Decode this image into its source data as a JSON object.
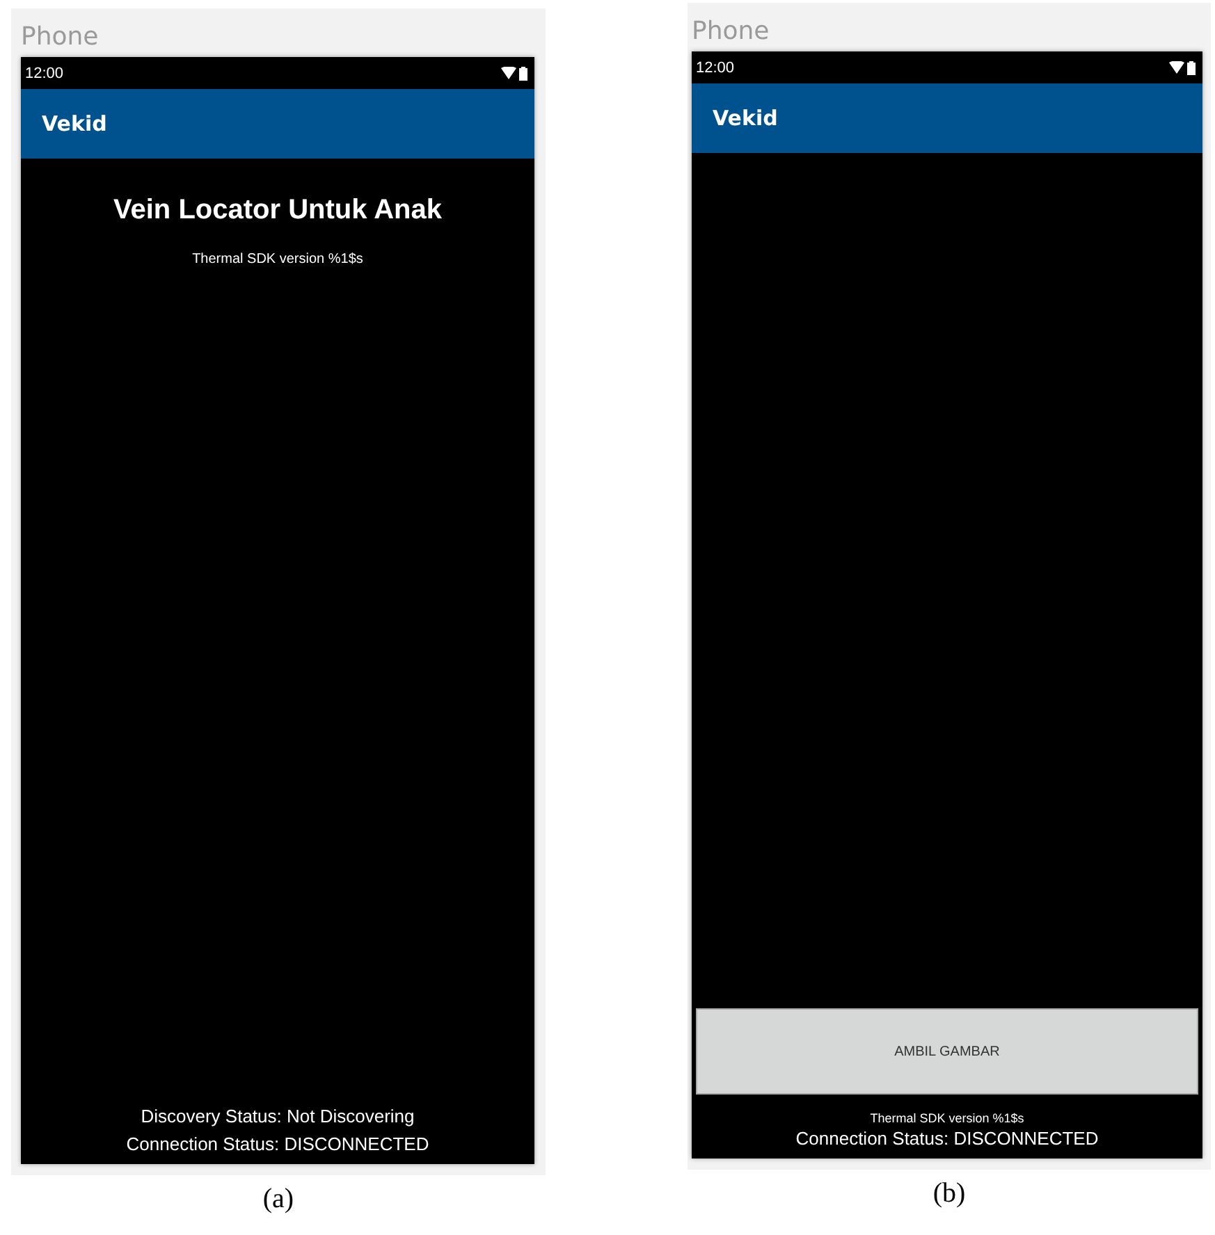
{
  "panels": [
    {
      "label": "Phone",
      "time": "12:00",
      "app_title": "Vekid",
      "top_texts": [
        {
          "kind": "heading",
          "text": "Vein Locator Untuk Anak"
        },
        {
          "kind": "small",
          "text": "Thermal SDK version %1$s"
        }
      ],
      "bottom_texts": [
        {
          "kind": "status",
          "text": "Discovery Status: Not Discovering"
        },
        {
          "kind": "status",
          "text": "Connection Status: DISCONNECTED"
        }
      ],
      "caption": "(a)"
    },
    {
      "label": "Phone",
      "time": "12:00",
      "app_title": "Vekid",
      "button": "AMBIL GAMBAR",
      "bottom_texts": [
        {
          "kind": "small",
          "text": "Thermal SDK version %1$s"
        },
        {
          "kind": "status",
          "text": "Connection Status: DISCONNECTED"
        }
      ],
      "caption": "(b)"
    }
  ]
}
